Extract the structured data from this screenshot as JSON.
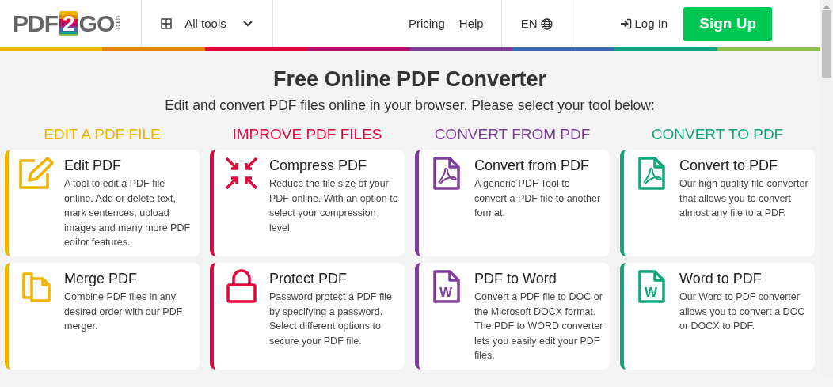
{
  "header": {
    "logo": {
      "left": "PDF",
      "badge": "2",
      "right": "GO",
      "suffix": ".com"
    },
    "all_tools": "All tools",
    "nav": [
      "Pricing",
      "Help"
    ],
    "language": "EN",
    "login": "Log In",
    "signup": "Sign Up"
  },
  "title": "Free Online PDF Converter",
  "subtitle": "Edit and convert PDF files online in your browser. Please select your tool below:",
  "columns": [
    {
      "heading": "EDIT A PDF FILE",
      "color": "#f0b400",
      "tools": [
        {
          "kind": "pencil",
          "name": "Edit PDF",
          "description": "A tool to edit a PDF file online. Add or delete text, mark sentences, upload images and many more PDF editor features."
        },
        {
          "kind": "merge",
          "name": "Merge PDF",
          "description": "Combine PDF files in any desired order with our PDF merger."
        }
      ]
    },
    {
      "heading": "IMPROVE PDF FILES",
      "color": "#e0073b",
      "tools": [
        {
          "kind": "compress",
          "name": "Compress PDF",
          "description": "Reduce the file size of your PDF online. With an option to select your compression level."
        },
        {
          "kind": "lock",
          "name": "Protect PDF",
          "description": "Password protect a PDF file by specifying a password. Select different options to secure your PDF file."
        }
      ]
    },
    {
      "heading": "CONVERT FROM PDF",
      "color": "#7d3c98",
      "tools": [
        {
          "kind": "pdf",
          "name": "Convert from PDF",
          "description": "A generic PDF Tool to convert a PDF file to another format."
        },
        {
          "kind": "word",
          "icon_text": "W",
          "name": "PDF to Word",
          "description": "Convert a PDF file to DOC or the Microsoft DOCX format. The PDF to WORD converter lets you easily edit your PDF files."
        }
      ]
    },
    {
      "heading": "CONVERT TO PDF",
      "color": "#12a67e",
      "tools": [
        {
          "kind": "pdf",
          "name": "Convert to PDF",
          "description": "Our high quality file converter that allows you to convert almost any file to a PDF."
        },
        {
          "kind": "word",
          "icon_text": "W",
          "name": "Word to PDF",
          "description": "Our Word to PDF converter allows you to convert a DOC or DOCX to PDF."
        }
      ]
    }
  ]
}
